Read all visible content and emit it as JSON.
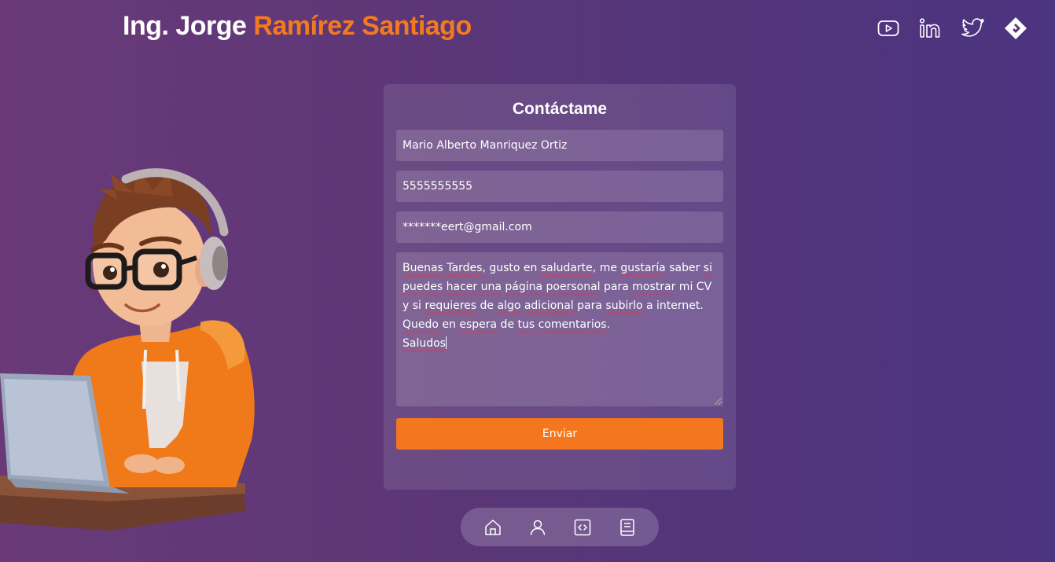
{
  "header": {
    "name_first": "Ing. Jorge ",
    "name_accent": "Ramírez Santiago"
  },
  "socials": [
    {
      "icon": "youtube-icon"
    },
    {
      "icon": "linkedin-icon"
    },
    {
      "icon": "twitter-icon"
    },
    {
      "icon": "brand-logo-icon"
    }
  ],
  "contact": {
    "title": "Contáctame",
    "name_value": "Mario Alberto Manriquez Ortiz",
    "phone_value": "5555555555",
    "email_value": "*******eert@gmail.com",
    "message_lines": [
      "Buenas Tardes, gusto en saludarte, me gustaría saber si",
      "puedes hacer una página poersonal para mostrar mi CV",
      "y si requieres de algo adicional para subirlo a internet.",
      "Quedo en espera de tus comentarios.",
      "Saludos"
    ],
    "submit_label": "Enviar"
  },
  "bottom_nav": [
    {
      "icon": "home-icon"
    },
    {
      "icon": "user-icon"
    },
    {
      "icon": "code-icon"
    },
    {
      "icon": "document-icon"
    }
  ],
  "colors": {
    "accent": "#f47a20",
    "background_left": "#6a3a78",
    "background_right": "#4b3480"
  }
}
